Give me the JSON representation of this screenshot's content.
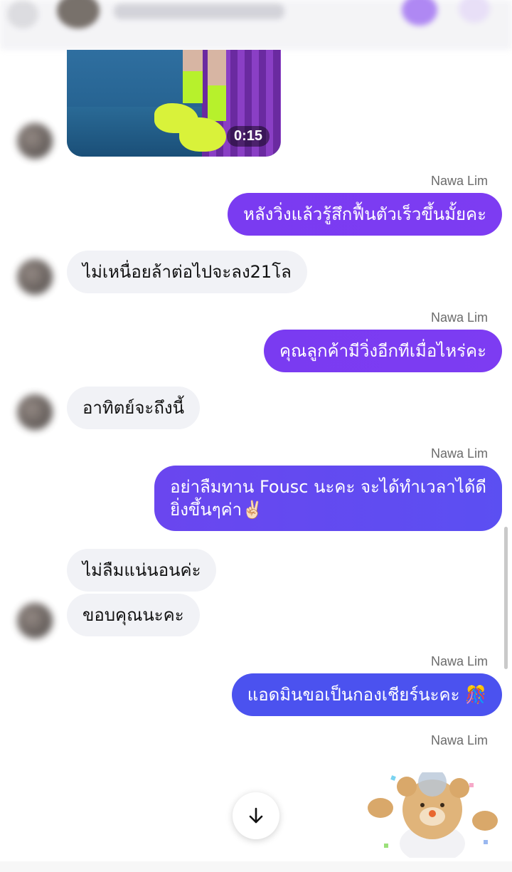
{
  "video": {
    "duration": "0:15"
  },
  "messages": {
    "m1": {
      "sender": "Nawa Lim",
      "text": "หลังวิ่งแล้วรู้สึกฟื้นตัวเร็วขึ้นมั้ยคะ"
    },
    "m2": {
      "text": "ไม่เหนื่อยล้าต่อไปจะลง21โล"
    },
    "m3": {
      "sender": "Nawa Lim",
      "text": "คุณลูกค้ามีวิ่งอีกทีเมื่อไหร่คะ"
    },
    "m4": {
      "text": "อาทิตย์จะถึงนี้"
    },
    "m5": {
      "sender": "Nawa Lim",
      "line1": "อย่าลืมทาน Fousc นะคะ จะได้ทำเวลาได้ดี",
      "line2": "ยิ่งขึ้นๆค่า✌🏻"
    },
    "m6": {
      "text": "ไม่ลืมแน่นอนค่ะ"
    },
    "m7": {
      "text": "ขอบคุณนะคะ"
    },
    "m8": {
      "sender": "Nawa Lim",
      "text": "แอดมินขอเป็นกองเชียร์นะคะ 🎊"
    },
    "m9": {
      "sender": "Nawa Lim"
    }
  },
  "icons": {
    "scroll_down": "arrow-down-icon",
    "sticker": "teddy-bear-sticker"
  },
  "colors": {
    "outgoing_start": "#7a3bf1",
    "outgoing_end": "#4b52ef",
    "incoming": "#f1f2f6"
  }
}
